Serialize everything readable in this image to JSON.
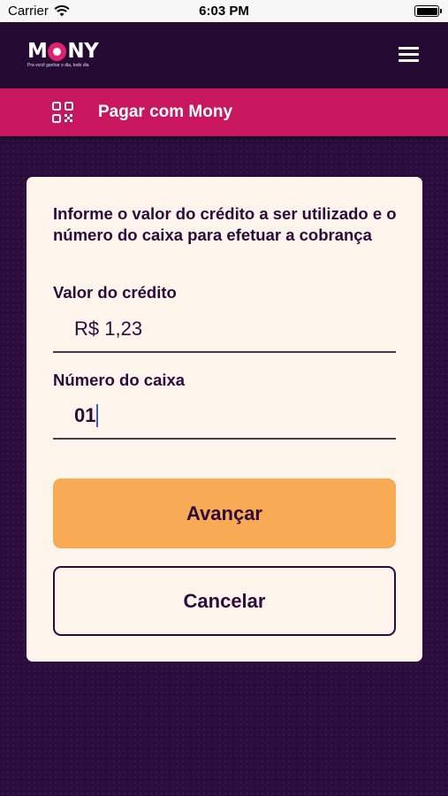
{
  "status_bar": {
    "carrier": "Carrier",
    "time": "6:03 PM",
    "wifi_icon": "wifi-icon",
    "battery_icon": "battery-icon"
  },
  "header": {
    "logo_text_left": "M",
    "logo_text_right": "NY",
    "logo_tagline": "Pra você ganhar o dia, todo dia",
    "menu_icon": "hamburger-menu-icon",
    "bg_color": "#250a33"
  },
  "title_bar": {
    "icon": "qr-code-icon",
    "title": "Pagar com Mony",
    "bg_color": "#c8175f"
  },
  "form": {
    "intro": "Informe o valor do crédito a ser utilizado e o número do caixa para efetuar a cobrança",
    "credit_label": "Valor do crédito",
    "credit_value": "R$ 1,23",
    "box_label": "Número do caixa",
    "box_value": "01",
    "next_label": "Avançar",
    "cancel_label": "Cancelar",
    "accent_color": "#f9aa54"
  }
}
